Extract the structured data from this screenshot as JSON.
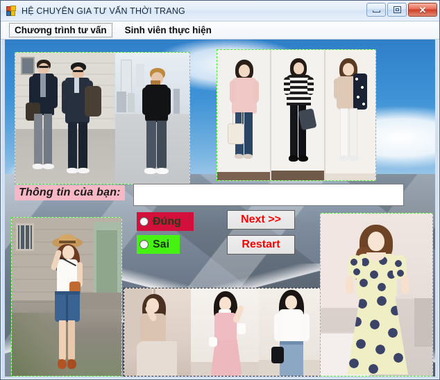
{
  "window": {
    "title": "HỆ CHUYÊN GIA TƯ VẤN THỜI TRANG",
    "icon": "vb-form-icon",
    "buttons": {
      "minimize": "minimize-icon",
      "maximize": "maximize-icon",
      "close": "✕"
    }
  },
  "menu": {
    "items": [
      {
        "label": "Chương trình tư vấn",
        "focused": true
      },
      {
        "label": "Sinh viên thực hiện",
        "focused": false
      }
    ]
  },
  "form": {
    "info_label": "Thông tin của bạn:",
    "answer_input": {
      "value": "",
      "placeholder": ""
    },
    "radios": [
      {
        "label": "Đúng",
        "selected": false,
        "bg": "#d3103c",
        "fg": "#1f3d16"
      },
      {
        "label": "Sai",
        "selected": false,
        "bg": "#46f211",
        "fg": "#14320a"
      }
    ],
    "buttons": [
      {
        "label": "Next >>",
        "color": "#ff0000"
      },
      {
        "label": "Restart",
        "color": "#ff0000"
      }
    ]
  },
  "pictures": [
    {
      "name": "mens-streetwear-suits",
      "border": "#49f02a",
      "style": "dashed"
    },
    {
      "name": "womens-casual-trio",
      "border": "#49f02a",
      "style": "dashed"
    },
    {
      "name": "woman-denim-skirt-hat",
      "border": "#49f02a",
      "style": "dashed"
    },
    {
      "name": "womens-pastel-trio",
      "border": "#2b2b2b",
      "style": "dashed"
    },
    {
      "name": "woman-floral-dress",
      "border": "#49f02a",
      "style": "dashed"
    }
  ],
  "background": {
    "name": "sky-and-mountains-wallpaper",
    "sky": "#3f93d6",
    "mountain": "#6a7687"
  }
}
